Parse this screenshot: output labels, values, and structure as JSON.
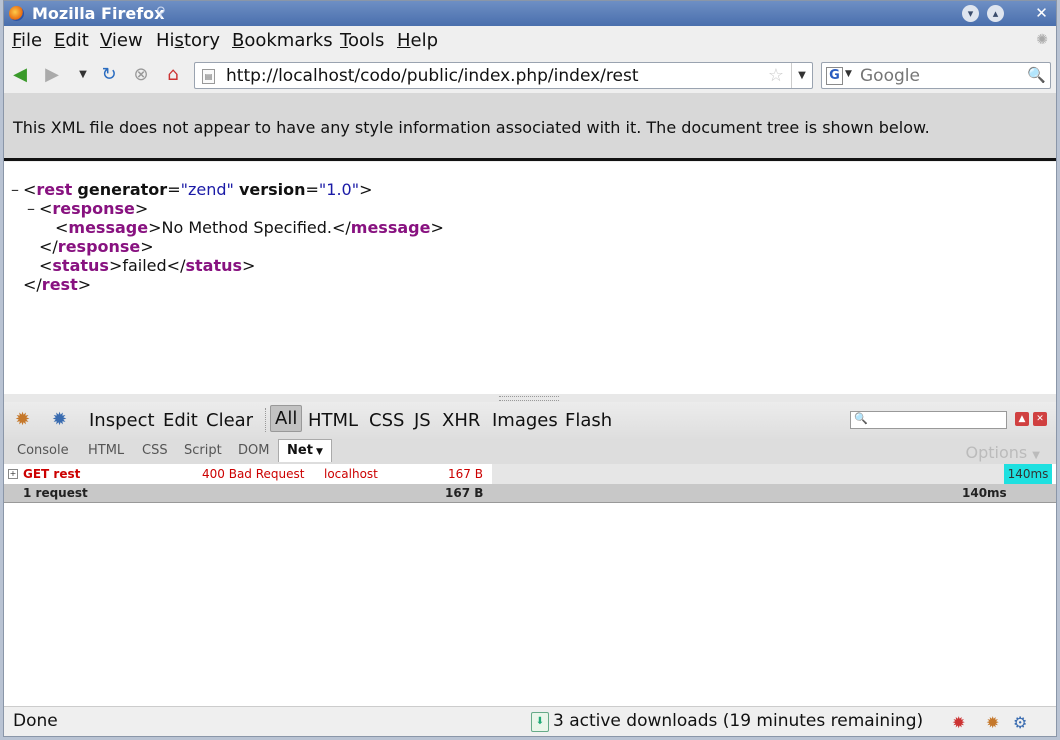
{
  "window": {
    "title": "Mozilla Firefox"
  },
  "menu": [
    {
      "label": "File",
      "key": "F"
    },
    {
      "label": "Edit",
      "key": "E"
    },
    {
      "label": "View",
      "key": "V"
    },
    {
      "label": "History",
      "key": "s"
    },
    {
      "label": "Bookmarks",
      "key": "B"
    },
    {
      "label": "Tools",
      "key": "T"
    },
    {
      "label": "Help",
      "key": "H"
    }
  ],
  "nav": {
    "url": "http://localhost/codo/public/index.php/index/rest",
    "search_placeholder": "Google"
  },
  "notice": "This XML file does not appear to have any style information associated with it. The document tree is shown below.",
  "xml": {
    "root_tag": "rest",
    "attr1_name": "generator",
    "attr1_value": "\"zend\"",
    "attr2_name": "version",
    "attr2_value": "\"1.0\"",
    "response_tag": "response",
    "message_tag": "message",
    "message_text": "No Method Specified.",
    "status_tag": "status",
    "status_text": "failed"
  },
  "firebug": {
    "toolbar": [
      "Inspect",
      "Edit",
      "Clear",
      "All",
      "HTML",
      "CSS",
      "JS",
      "XHR",
      "Images",
      "Flash"
    ],
    "active_filter": "All",
    "tabs": [
      "Console",
      "HTML",
      "CSS",
      "Script",
      "DOM",
      "Net"
    ],
    "active_tab": "Net",
    "options_label": "Options",
    "request": {
      "label": "GET rest",
      "status": "400 Bad Request",
      "domain": "localhost",
      "size": "167 B",
      "time": "140ms"
    },
    "summary": {
      "count": "1 request",
      "size": "167 B",
      "time": "140ms"
    }
  },
  "statusbar": {
    "left": "Done",
    "downloads": "3 active downloads (19 minutes remaining)"
  }
}
